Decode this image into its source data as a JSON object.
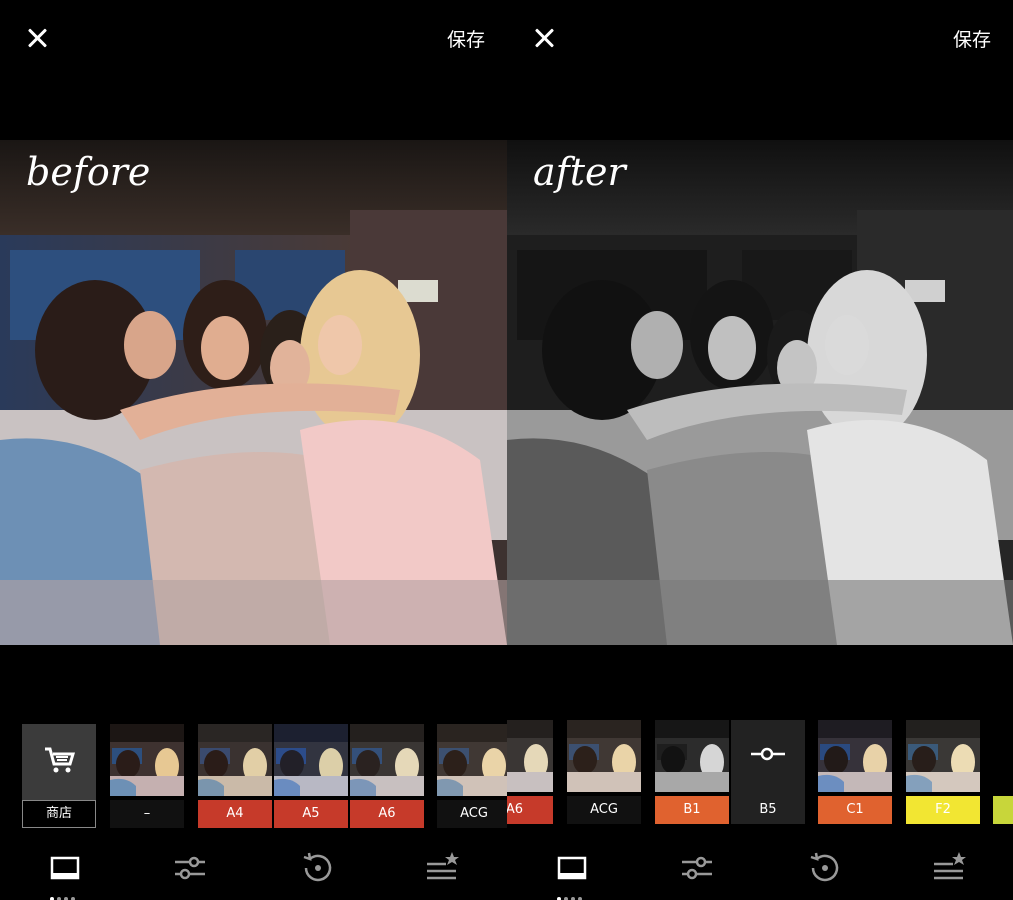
{
  "left_panel": {
    "close_icon": "close-icon",
    "save_label": "保存",
    "caption": "before",
    "filters": [
      {
        "label": "商店",
        "icon": "shop-cart-icon",
        "kind": "shop"
      },
      {
        "label": "–",
        "style": "dark"
      },
      {
        "label": "A4",
        "style": "red"
      },
      {
        "label": "A5",
        "style": "red"
      },
      {
        "label": "A6",
        "style": "red"
      },
      {
        "label": "ACG",
        "style": "dark"
      }
    ],
    "tools": [
      "frame-icon",
      "adjust-sliders-icon",
      "history-icon",
      "recipe-favorites-icon"
    ]
  },
  "right_panel": {
    "close_icon": "close-icon",
    "save_label": "保存",
    "caption": "after",
    "filters": [
      {
        "label": "A6",
        "style": "red"
      },
      {
        "label": "ACG",
        "style": "dark"
      },
      {
        "label": "B1",
        "style": "orange"
      },
      {
        "label": "B5",
        "style": "dark",
        "selected": true
      },
      {
        "label": "C1",
        "style": "orange"
      },
      {
        "label": "F2",
        "style": "yellow"
      }
    ],
    "tools": [
      "frame-icon",
      "adjust-sliders-icon",
      "history-icon",
      "recipe-favorites-icon"
    ]
  },
  "colors": {
    "red_label": "#c63a2a",
    "orange_label": "#e0622f",
    "yellow_label": "#f2e632"
  }
}
